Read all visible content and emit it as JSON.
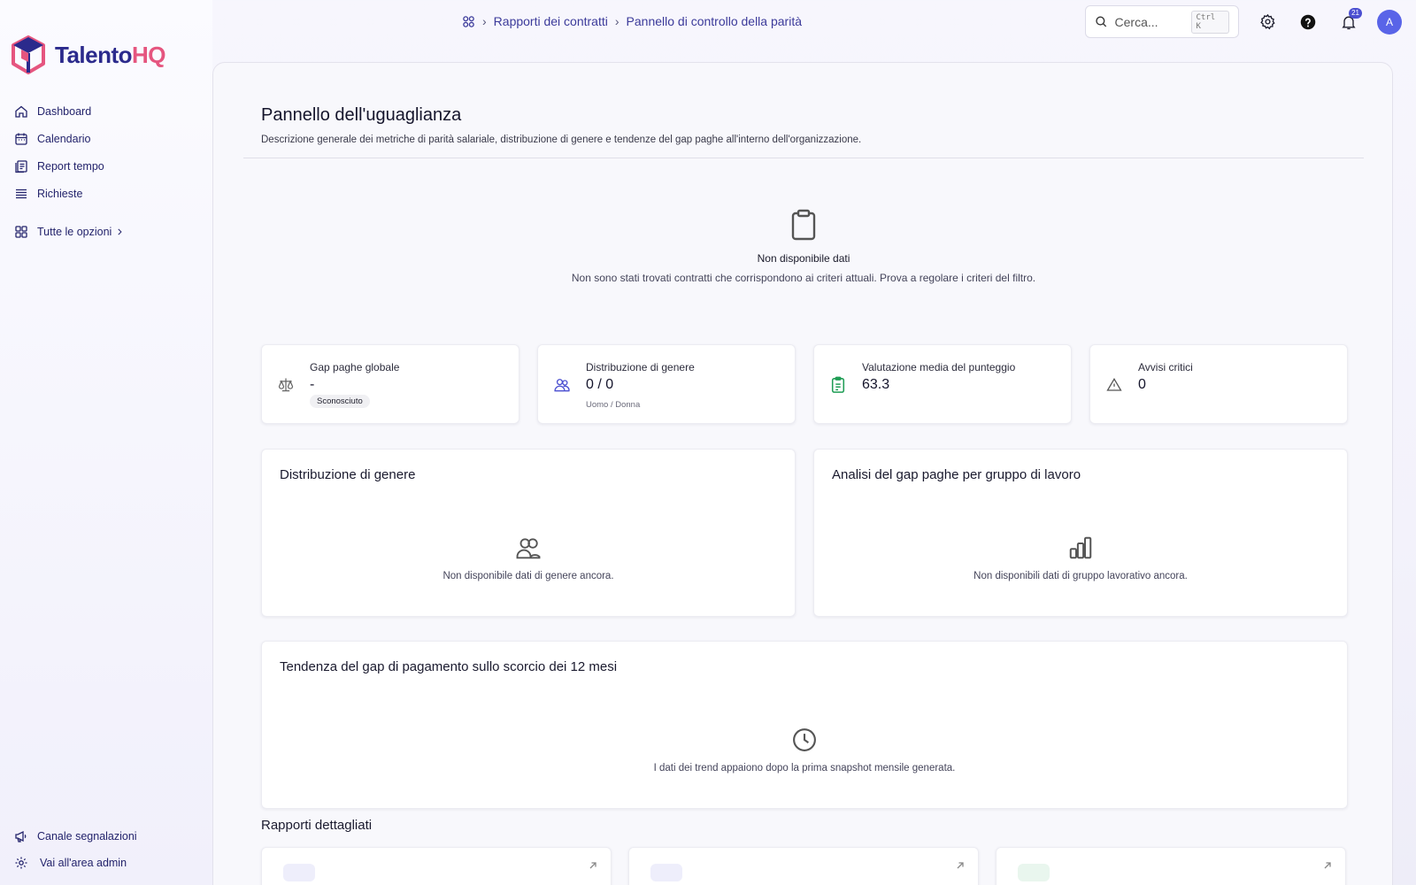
{
  "app": {
    "brand_part1": "Talento",
    "brand_part2": "HQ"
  },
  "sidebar": {
    "items": [
      {
        "label": "Dashboard",
        "icon": "home-icon"
      },
      {
        "label": "Calendario",
        "icon": "calendar-icon"
      },
      {
        "label": "Report tempo",
        "icon": "report-icon"
      },
      {
        "label": "Richieste",
        "icon": "list-icon"
      }
    ],
    "all_options": "Tutte le opzioni",
    "bottom": [
      {
        "label": "Canale segnalazioni",
        "icon": "megaphone-icon"
      },
      {
        "label": "Vai all'area admin",
        "icon": "gear-icon"
      }
    ]
  },
  "breadcrumb": {
    "item1": "Rapporti dei contratti",
    "item2": "Pannello di controllo della parità"
  },
  "search": {
    "placeholder": "Cerca...",
    "shortcut": "Ctrl K"
  },
  "notifications": {
    "count": "21"
  },
  "user": {
    "initial": "A"
  },
  "page": {
    "title": "Pannello dell'uguaglianza",
    "description": "Descrizione generale dei metriche di parità salariale, distribuzione di genere e tendenze del gap paghe all'interno dell'organizzazione."
  },
  "empty_state": {
    "title": "Non disponibile dati",
    "message": "Non sono stati trovati contratti che corrispondono ai criteri attuali. Prova a regolare i criteri del filtro."
  },
  "stats": [
    {
      "label": "Gap paghe globale",
      "value": "-",
      "pill": "Sconosciuto"
    },
    {
      "label": "Distribuzione di genere",
      "value": "0 / 0",
      "sub": "Uomo / Donna"
    },
    {
      "label": "Valutazione media del punteggio",
      "value": "63.3"
    },
    {
      "label": "Avvisi critici",
      "value": "0"
    }
  ],
  "panels": {
    "gender": {
      "title": "Distribuzione di genere",
      "empty": "Non disponibile dati di genere ancora."
    },
    "workgroup": {
      "title": "Analisi del gap paghe per gruppo di lavoro",
      "empty": "Non disponibili dati di gruppo lavorativo ancora."
    },
    "trend": {
      "title": "Tendenza del gap di pagamento sullo scorcio dei 12 mesi",
      "empty": "I dati dei trend appaiono dopo la prima snapshot mensile generata."
    }
  },
  "reports": {
    "title": "Rapporti dettagliati"
  },
  "colors": {
    "accent": "#3b3a9a",
    "brand_pink": "#e5557f",
    "success": "#1f9d55"
  }
}
